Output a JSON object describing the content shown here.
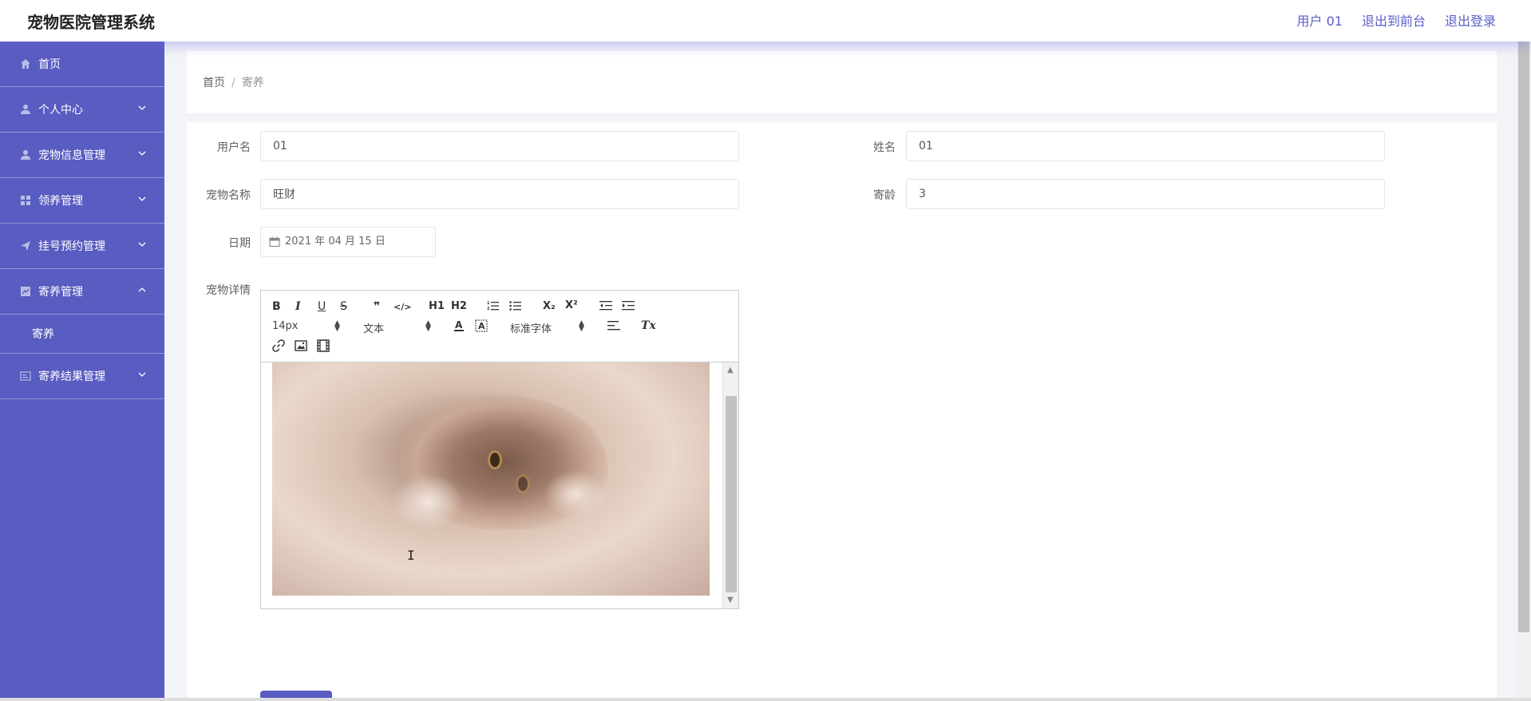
{
  "header": {
    "title": "宠物医院管理系统",
    "user_label": "用户 01",
    "exit_front_label": "退出到前台",
    "logout_label": "退出登录",
    "accent_color": "#595cc0"
  },
  "sidebar": {
    "items": [
      {
        "label": "首页",
        "icon": "home-icon",
        "expandable": false
      },
      {
        "label": "个人中心",
        "icon": "user-icon",
        "expandable": true
      },
      {
        "label": "宠物信息管理",
        "icon": "user-icon",
        "expandable": true
      },
      {
        "label": "领养管理",
        "icon": "grid-icon",
        "expandable": true
      },
      {
        "label": "挂号预约管理",
        "icon": "send-icon",
        "expandable": true
      },
      {
        "label": "寄养管理",
        "icon": "chart-icon",
        "expandable": true,
        "expanded": true
      },
      {
        "label": "寄养结果管理",
        "icon": "card-icon",
        "expandable": true
      }
    ],
    "submenu": {
      "label": "寄养"
    }
  },
  "breadcrumb": {
    "home": "首页",
    "separator": "/",
    "current": "寄养"
  },
  "form": {
    "username": {
      "label": "用户名",
      "value": "01"
    },
    "name": {
      "label": "姓名",
      "value": "01"
    },
    "pet_name": {
      "label": "宠物名称",
      "value": "旺财"
    },
    "pet_age": {
      "label": "寄龄",
      "value": "3"
    },
    "date": {
      "label": "日期",
      "value": "2021 年 04 月 15 日"
    },
    "details": {
      "label": "宠物详情"
    }
  },
  "editor": {
    "font_size": "14px",
    "block_type": "文本",
    "font_family": "标准字体",
    "buttons": {
      "bold": "B",
      "italic": "I",
      "underline": "U",
      "strike": "S",
      "quote": "❞",
      "code": "</>",
      "h1": "H1",
      "h2": "H2",
      "subscript": "X₂",
      "superscript": "X²",
      "clear_format": "Tx"
    }
  }
}
